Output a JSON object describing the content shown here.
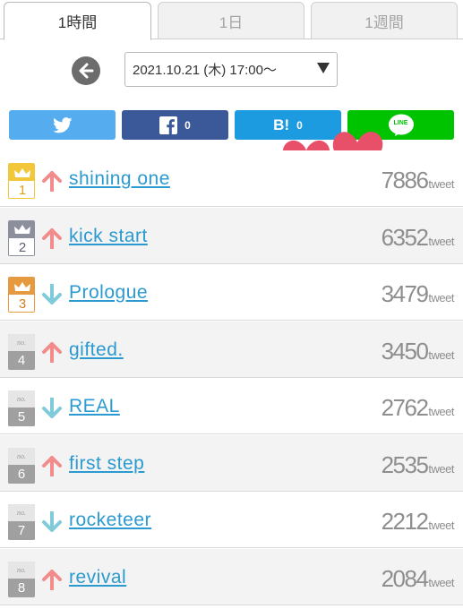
{
  "tabs": [
    {
      "label": "1時間",
      "active": true
    },
    {
      "label": "1日",
      "active": false
    },
    {
      "label": "1週間",
      "active": false
    }
  ],
  "date_selector": {
    "value": "2021.10.21 (木) 17:00～",
    "back_icon": "arrow-left-circle-icon",
    "caret_icon": "triangle-down-icon"
  },
  "share": {
    "twitter": {
      "icon": "twitter-bird-icon",
      "color": "#55acee"
    },
    "facebook": {
      "icon": "facebook-f-icon",
      "count": "0",
      "color": "#3b5998"
    },
    "hatena": {
      "label": "B!",
      "count": "0",
      "color": "#1d9be0"
    },
    "line": {
      "label": "LINE",
      "color": "#00c300"
    }
  },
  "sticker": {
    "icon": "two-hearts-sticker",
    "color": "#e8506a"
  },
  "rankings": [
    {
      "rank": "1",
      "badge": "gold",
      "trend": "up",
      "title": "shining one",
      "count": "7886",
      "unit": "tweet"
    },
    {
      "rank": "2",
      "badge": "silver",
      "trend": "up",
      "title": "kick start",
      "count": "6352",
      "unit": "tweet"
    },
    {
      "rank": "3",
      "badge": "bronze",
      "trend": "down",
      "title": "Prologue",
      "count": "3479",
      "unit": "tweet"
    },
    {
      "rank": "4",
      "badge": "plain",
      "badge_label": "no.",
      "trend": "up",
      "title": "gifted.",
      "count": "3450",
      "unit": "tweet"
    },
    {
      "rank": "5",
      "badge": "plain",
      "badge_label": "no.",
      "trend": "down",
      "title": "REAL",
      "count": "2762",
      "unit": "tweet"
    },
    {
      "rank": "6",
      "badge": "plain",
      "badge_label": "no.",
      "trend": "up",
      "title": "first step",
      "count": "2535",
      "unit": "tweet"
    },
    {
      "rank": "7",
      "badge": "plain",
      "badge_label": "no.",
      "trend": "down",
      "title": "rocketeer",
      "count": "2212",
      "unit": "tweet"
    },
    {
      "rank": "8",
      "badge": "plain",
      "badge_label": "no.",
      "trend": "up",
      "title": "revival",
      "count": "2084",
      "unit": "tweet"
    }
  ],
  "colors": {
    "up_arrow": "#f28b8b",
    "down_arrow": "#7fcbd9",
    "link": "#2a9ad0",
    "count": "#8e8e8e"
  }
}
